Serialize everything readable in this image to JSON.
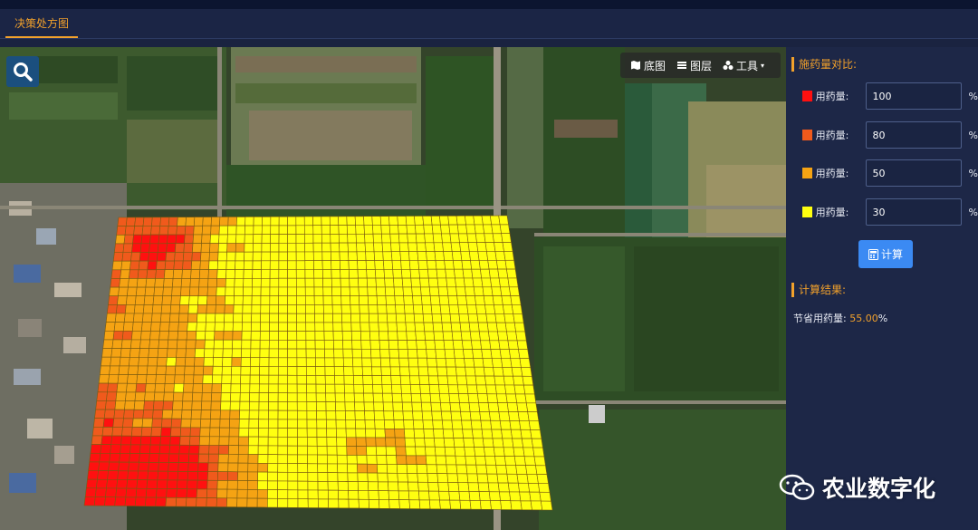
{
  "tab": {
    "label": "决策处方图"
  },
  "map_tools": {
    "basemap": "底图",
    "layers": "图层",
    "tools": "工具"
  },
  "panel": {
    "compare_title": "施药量对比:",
    "rows": [
      {
        "label": "用药量:",
        "value": "100",
        "unit": "%",
        "color": "#ff1010"
      },
      {
        "label": "用药量:",
        "value": "80",
        "unit": "%",
        "color": "#f05a1c"
      },
      {
        "label": "用药量:",
        "value": "50",
        "unit": "%",
        "color": "#f5a313"
      },
      {
        "label": "用药量:",
        "value": "30",
        "unit": "%",
        "color": "#ffff10"
      }
    ],
    "calc_button": "计算",
    "result_title": "计算结果:",
    "result_label": "节省用药量:",
    "result_value": "55.00",
    "result_unit": "%"
  },
  "watermark": "农业数字化",
  "prescription_colors": [
    "#ff1010",
    "#f05a1c",
    "#f5a313",
    "#ffff10"
  ]
}
